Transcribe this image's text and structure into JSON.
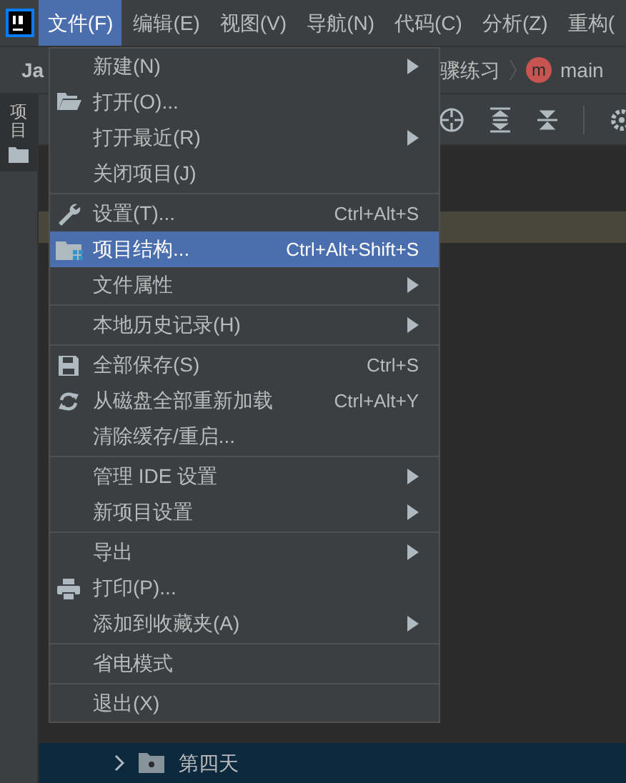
{
  "menubar": [
    {
      "label": "文件(F)",
      "selected": true
    },
    {
      "label": "编辑(E)",
      "selected": false
    },
    {
      "label": "视图(V)",
      "selected": false
    },
    {
      "label": "导航(N)",
      "selected": false
    },
    {
      "label": "代码(C)",
      "selected": false
    },
    {
      "label": "分析(Z)",
      "selected": false
    },
    {
      "label": "重构(",
      "selected": false
    }
  ],
  "navbar": {
    "project": "Ja",
    "breadcrumb": "骤练习",
    "branch_badge": "m",
    "branch": "main"
  },
  "side_tab": {
    "label": "项目",
    "selected": true
  },
  "tree": [
    {
      "label": "第四天",
      "selected": true
    }
  ],
  "menu": [
    {
      "kind": "item",
      "label": "新建(N)",
      "submenu": true,
      "selected": false
    },
    {
      "kind": "item",
      "label": "打开(O)...",
      "selected": false
    },
    {
      "kind": "item",
      "label": "打开最近(R)",
      "submenu": true,
      "selected": false
    },
    {
      "kind": "item",
      "label": "关闭项目(J)",
      "selected": false
    },
    {
      "kind": "separator"
    },
    {
      "kind": "item",
      "label": "设置(T)...",
      "shortcut": "Ctrl+Alt+S",
      "selected": false
    },
    {
      "kind": "item",
      "label": "项目结构...",
      "shortcut": "Ctrl+Alt+Shift+S",
      "selected": true
    },
    {
      "kind": "item",
      "label": "文件属性",
      "submenu": true,
      "selected": false
    },
    {
      "kind": "separator"
    },
    {
      "kind": "item",
      "label": "本地历史记录(H)",
      "submenu": true,
      "selected": false
    },
    {
      "kind": "separator"
    },
    {
      "kind": "item",
      "label": "全部保存(S)",
      "shortcut": "Ctrl+S",
      "selected": false
    },
    {
      "kind": "item",
      "label": "从磁盘全部重新加载",
      "shortcut": "Ctrl+Alt+Y",
      "selected": false
    },
    {
      "kind": "item",
      "label": "清除缓存/重启...",
      "selected": false
    },
    {
      "kind": "separator"
    },
    {
      "kind": "item",
      "label": "管理 IDE 设置",
      "submenu": true,
      "selected": false
    },
    {
      "kind": "item",
      "label": "新项目设置",
      "submenu": true,
      "selected": false
    },
    {
      "kind": "separator"
    },
    {
      "kind": "item",
      "label": "导出",
      "submenu": true,
      "selected": false
    },
    {
      "kind": "item",
      "label": "打印(P)...",
      "selected": false
    },
    {
      "kind": "item",
      "label": "添加到收藏夹(A)",
      "submenu": true,
      "selected": false
    },
    {
      "kind": "separator"
    },
    {
      "kind": "item",
      "label": "省电模式",
      "selected": false
    },
    {
      "kind": "separator"
    },
    {
      "kind": "item",
      "label": "退出(X)",
      "selected": false
    }
  ]
}
